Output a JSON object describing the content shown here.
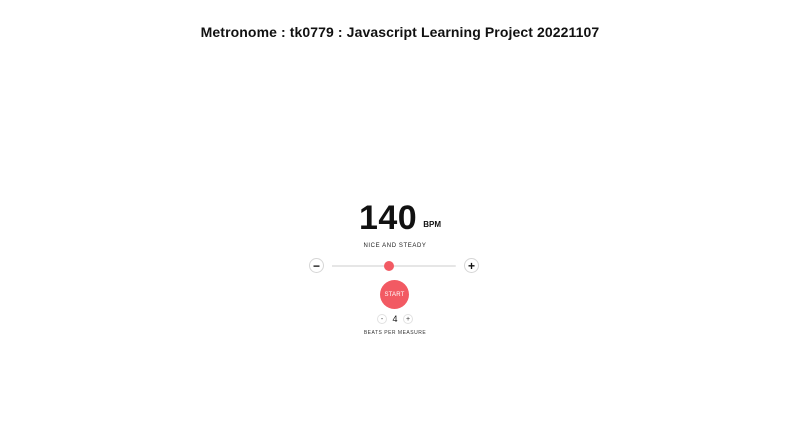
{
  "page": {
    "title": "Metronome : tk0779 : Javascript Learning Project 20221107"
  },
  "metronome": {
    "tempo": "140",
    "unit": "BPM",
    "tempo_text": "NICE AND STEADY",
    "decrease_label": "−",
    "increase_label": "+",
    "slider": {
      "min": 20,
      "max": 280,
      "value": 140
    },
    "start_label": "START",
    "beats": {
      "decrease_label": "-",
      "count": "4",
      "increase_label": "+",
      "label": "BEATS PER MEASURE"
    }
  },
  "colors": {
    "accent": "#f25a63",
    "track": "#e6e6e6"
  }
}
